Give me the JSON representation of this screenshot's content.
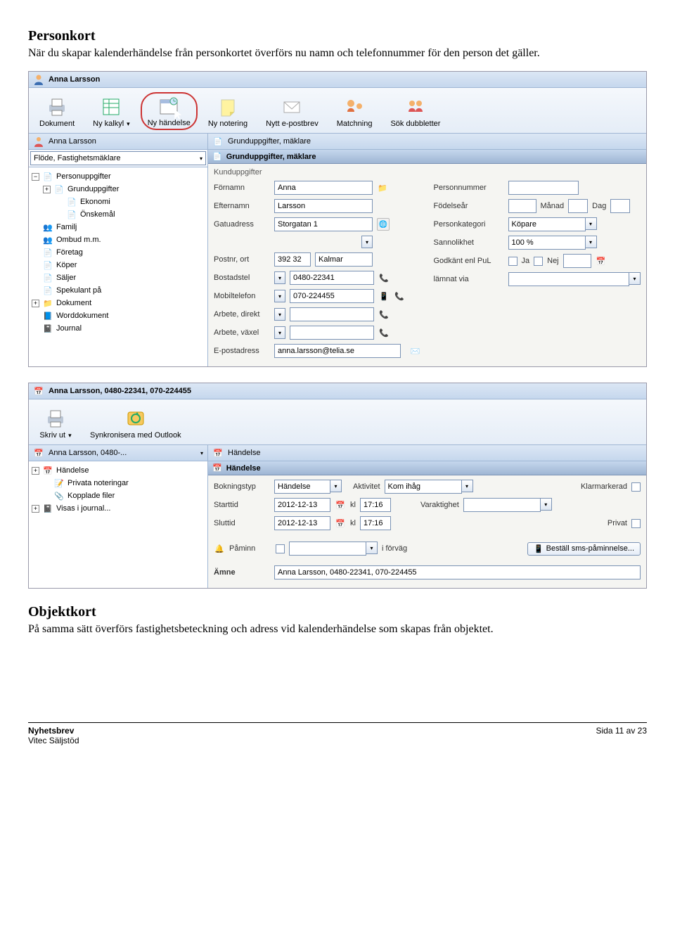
{
  "doc": {
    "section1_title": "Personkort",
    "section1_body": "När du skapar kalenderhändelse från personkortet överförs nu namn och telefonnummer för den person det gäller.",
    "section2_title": "Objektkort",
    "section2_body": "På samma sätt överförs fastighetsbeteckning och adress vid kalenderhändelse som skapas från objektet.",
    "footer_left1": "Nyhetsbrev",
    "footer_left2": "Vitec Säljstöd",
    "footer_right": "Sida 11 av 23"
  },
  "shot1": {
    "title": "Anna Larsson",
    "toolbar": [
      {
        "label": "Dokument"
      },
      {
        "label": "Ny kalkyl"
      },
      {
        "label": "Ny händelse"
      },
      {
        "label": "Ny notering"
      },
      {
        "label": "Nytt e-postbrev"
      },
      {
        "label": "Matchning"
      },
      {
        "label": "Sök dubbletter"
      }
    ],
    "left_header": "Anna Larsson",
    "flowlabel": "Flöde, Fastighetsmäklare",
    "tree": [
      "Personuppgifter",
      "Grunduppgifter",
      "Ekonomi",
      "Önskemål",
      "Familj",
      "Ombud m.m.",
      "Företag",
      "Köper",
      "Säljer",
      "Spekulant på",
      "Dokument",
      "Worddokument",
      "Journal"
    ],
    "right_header": "Grunduppgifter, mäklare",
    "section_header": "Grunduppgifter, mäklare",
    "group_label": "Kunduppgifter",
    "fields": {
      "fornamn_l": "Förnamn",
      "fornamn_v": "Anna",
      "efternamn_l": "Efternamn",
      "efternamn_v": "Larsson",
      "gatu_l": "Gatuadress",
      "gatu_v": "Storgatan 1",
      "postnr_l": "Postnr, ort",
      "postnr_v": "392 32",
      "ort_v": "Kalmar",
      "bostad_l": "Bostadstel",
      "bostad_v": "0480-22341",
      "mobil_l": "Mobiltelefon",
      "mobil_v": "070-224455",
      "arbdir_l": "Arbete, direkt",
      "arbdir_v": "",
      "arbvax_l": "Arbete, växel",
      "arbvax_v": "",
      "epost_l": "E-postadress",
      "epost_v": "anna.larsson@telia.se",
      "pnr_l": "Personnummer",
      "pnr_v": "",
      "fodar_l": "Födelseår",
      "fodar_v": "",
      "manad_l": "Månad",
      "dag_l": "Dag",
      "kat_l": "Personkategori",
      "kat_v": "Köpare",
      "sann_l": "Sannolikhet",
      "sann_v": "100 %",
      "pul_l": "Godkänt enl PuL",
      "ja": "Ja",
      "nej": "Nej",
      "lamnat_l": "lämnat via"
    }
  },
  "shot2": {
    "title": "Anna Larsson, 0480-22341, 070-224455",
    "toolbar": [
      {
        "label": "Skriv ut"
      },
      {
        "label": "Synkronisera med Outlook"
      }
    ],
    "left_header": "Anna Larsson, 0480-...",
    "tree": [
      "Händelse",
      "Privata noteringar",
      "Kopplade filer",
      "Visas i journal..."
    ],
    "right_header": "Händelse",
    "section_header": "Händelse",
    "fields": {
      "boktyp_l": "Bokningstyp",
      "boktyp_v": "Händelse",
      "akt_l": "Aktivitet",
      "akt_v": "Kom ihåg",
      "klar_l": "Klarmarkerad",
      "start_l": "Starttid",
      "start_d": "2012-12-13",
      "kl_l": "kl",
      "start_t": "17:16",
      "slut_l": "Sluttid",
      "slut_d": "2012-12-13",
      "slut_t": "17:16",
      "var_l": "Varaktighet",
      "var_v": "",
      "priv_l": "Privat",
      "paminn_l": "Påminn",
      "iforv_l": "i förväg",
      "sms_btn": "Beställ sms-påminnelse...",
      "amne_l": "Ämne",
      "amne_v": "Anna Larsson, 0480-22341, 070-224455"
    }
  }
}
